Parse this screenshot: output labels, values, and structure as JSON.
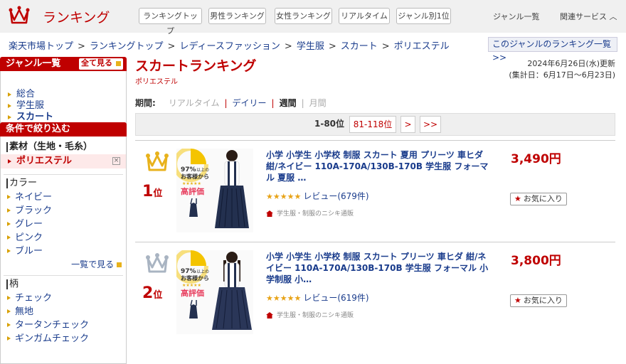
{
  "header": {
    "logo_text": "ランキング",
    "nav": [
      "ランキングトップ",
      "男性ランキング",
      "女性ランキング",
      "リアルタイム",
      "ジャンル別1位"
    ],
    "links": [
      "ジャンル一覧",
      "関連サービス ︿"
    ]
  },
  "breadcrumb": [
    "楽天市場トップ",
    "ランキングトップ",
    "レディースファッション",
    "学生服",
    "スカート",
    "ポリエステル"
  ],
  "genre_ranking_link": "このジャンルのランキング一覧 >>",
  "sidebar": {
    "genre": {
      "title": "ジャンル一覧",
      "all_label": "全て見る",
      "items": [
        "総合",
        "学生服",
        "スカート"
      ]
    },
    "filter": {
      "title": "条件で絞り込む",
      "material": {
        "title": "素材（生地・毛糸）",
        "selected": "ポリエステル",
        "remove": "×"
      },
      "color": {
        "title": "カラー",
        "items": [
          "ネイビー",
          "ブラック",
          "グレー",
          "ピンク",
          "ブルー"
        ],
        "more": "一覧で見る"
      },
      "pattern": {
        "title": "柄",
        "items": [
          "チェック",
          "無地",
          "タータンチェック",
          "ギンガムチェック"
        ]
      }
    }
  },
  "main": {
    "title": "スカートランキング",
    "subtitle": "ポリエステル",
    "updated": "2024年6月26日(水)更新",
    "period_range": "(集計日：6月17日〜6月23日)",
    "period": {
      "label": "期間:",
      "options": [
        "リアルタイム",
        "デイリー",
        "週間",
        "月間"
      ]
    },
    "pager": {
      "current": "1-80位",
      "next": "81-118位",
      "next_icon": ">",
      "last_icon": ">>"
    }
  },
  "items": [
    {
      "rank": "1",
      "rank_suffix": "位",
      "title": "小学 小学生 小学校 制服 スカート 夏用 プリーツ 車ヒダ 紺/ネイビー 110A-170A/130B-170B 学生服 フォーマル 夏服 …",
      "stars": "★★★★★",
      "review": "レビュー(679件)",
      "shop": "学生服・制服のニシキ通販",
      "price": "3,490円",
      "fav": "お気に入り",
      "crown_color": "#e8b21c",
      "thumb": {
        "pct": "97%",
        "line1": "以上の",
        "line2": "お客様から",
        "line3": "高評価"
      }
    },
    {
      "rank": "2",
      "rank_suffix": "位",
      "title": "小学 小学生 小学校 制服 スカート プリーツ 車ヒダ 紺/ネイビー 110A-170A/130B-170B 学生服 フォーマル 小学制服 小…",
      "stars": "★★★★★",
      "review": "レビュー(619件)",
      "shop": "学生服・制服のニシキ通販",
      "price": "3,800円",
      "fav": "お気に入り",
      "crown_color": "#a9b4c2",
      "thumb": {
        "pct": "97%",
        "line1": "以上の",
        "line2": "お客様から",
        "line3": "高評価"
      }
    }
  ]
}
